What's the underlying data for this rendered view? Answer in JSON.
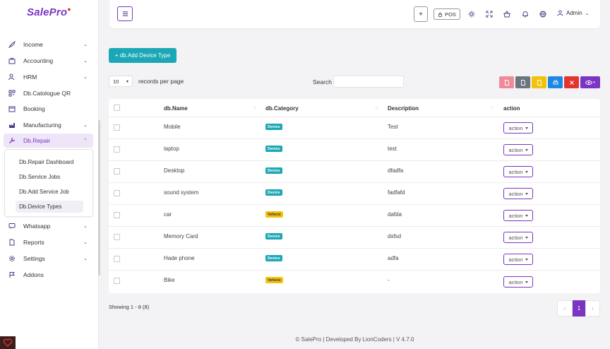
{
  "app": {
    "logo_text": "SalePro",
    "logo_mark": "●"
  },
  "sidebar": {
    "items": [
      {
        "label": "Income",
        "icon": "rocket-icon",
        "has_submenu": true
      },
      {
        "label": "Accounting",
        "icon": "briefcase-icon",
        "has_submenu": true
      },
      {
        "label": "HRM",
        "icon": "users-icon",
        "has_submenu": true
      },
      {
        "label": "Db.Catologue QR",
        "icon": "qr-icon",
        "has_submenu": false
      },
      {
        "label": "Booking",
        "icon": "calendar-icon",
        "has_submenu": false
      },
      {
        "label": "Manufacturing",
        "icon": "factory-icon",
        "has_submenu": true
      },
      {
        "label": "Db.Repair",
        "icon": "wrench-icon",
        "has_submenu": true
      },
      {
        "label": "Whatsapp",
        "icon": "chat-icon",
        "has_submenu": true
      },
      {
        "label": "Reports",
        "icon": "file-icon",
        "has_submenu": true
      },
      {
        "label": "Settings",
        "icon": "gear-icon",
        "has_submenu": true
      },
      {
        "label": "Addons",
        "icon": "flag-icon",
        "has_submenu": false
      }
    ],
    "repair_submenu": [
      "Db.Repair Dashboard",
      "Db.Service Jobs",
      "Db.Add Service Job",
      "Db.Device Types"
    ]
  },
  "header": {
    "plus_label": "+",
    "pos_label": "POS",
    "user_label": "Admin"
  },
  "toolbar": {
    "add_label": "+ db.Add Device Type",
    "page_size": "10",
    "per_page_label": "records per page",
    "search_label": "Search",
    "search_placeholder": ""
  },
  "table": {
    "columns": [
      "db.Name",
      "db.Category",
      "Description",
      "action"
    ],
    "rows": [
      {
        "name": "Mobile",
        "category": "Device",
        "description": "Test"
      },
      {
        "name": "laptop",
        "category": "Device",
        "description": "test"
      },
      {
        "name": "Desktop",
        "category": "Device",
        "description": "dfadfa"
      },
      {
        "name": "sound system",
        "category": "Device",
        "description": "fadfafd"
      },
      {
        "name": "car",
        "category": "Vehicle",
        "description": "dafda"
      },
      {
        "name": "Memory Card",
        "category": "Device",
        "description": "dsfsd"
      },
      {
        "name": "Hade phone",
        "category": "Device",
        "description": "adfa"
      },
      {
        "name": "Bike",
        "category": "Vehicle",
        "description": "-"
      }
    ],
    "action_label": "action"
  },
  "pagination": {
    "showing": "Showing 1 - 8 (8)",
    "prev": "‹",
    "current": "1",
    "next": "›"
  },
  "footer": {
    "text": "© SalePro | Developed By LionCoders | V 4.7.0"
  },
  "colors": {
    "accent": "#7a35c4",
    "teal": "#1ba7b5",
    "vehicle": "#f4c20d"
  }
}
